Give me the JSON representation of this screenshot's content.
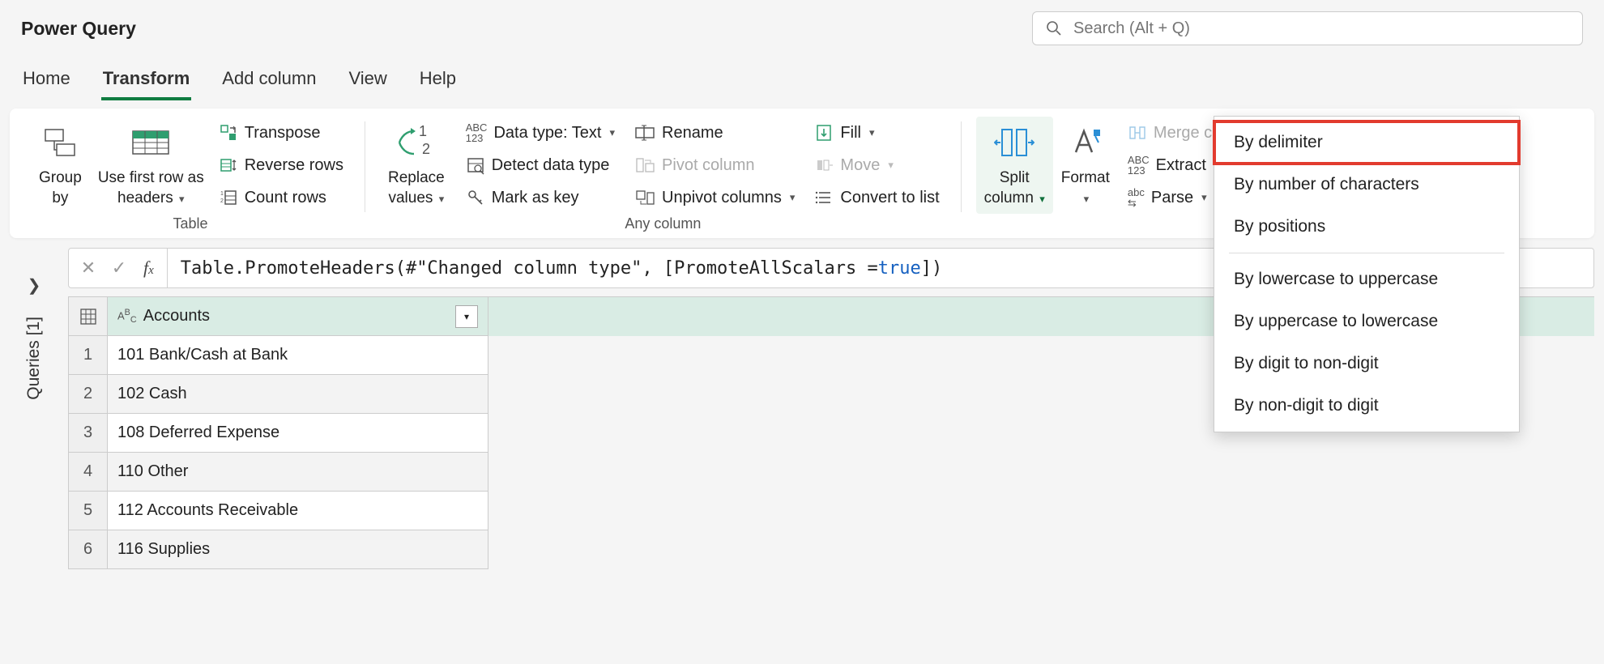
{
  "app": {
    "title": "Power Query"
  },
  "search": {
    "placeholder": "Search (Alt + Q)"
  },
  "tabs": {
    "home": "Home",
    "transform": "Transform",
    "add_column": "Add column",
    "view": "View",
    "help": "Help"
  },
  "ribbon": {
    "group_by": "Group\nby",
    "use_first_row": "Use first row as\nheaders",
    "transpose": "Transpose",
    "reverse_rows": "Reverse rows",
    "count_rows": "Count rows",
    "table_group": "Table",
    "replace_values": "Replace\nvalues",
    "data_type": "Data type: Text",
    "detect": "Detect data type",
    "mark_key": "Mark as key",
    "rename": "Rename",
    "pivot": "Pivot column",
    "unpivot": "Unpivot columns",
    "fill": "Fill",
    "move": "Move",
    "convert_list": "Convert to list",
    "any_column_group": "Any column",
    "split": "Split\ncolumn",
    "format": "Format",
    "merge_columns": "Merge columns",
    "extract": "Extract",
    "parse": "Parse"
  },
  "split_menu": {
    "by_delimiter": "By delimiter",
    "by_num_chars": "By number of characters",
    "by_positions": "By positions",
    "by_lower_upper": "By lowercase to uppercase",
    "by_upper_lower": "By uppercase to lowercase",
    "by_digit_nondigit": "By digit to non-digit",
    "by_nondigit_digit": "By non-digit to digit"
  },
  "queries": {
    "label": "Queries [1]"
  },
  "formula": {
    "prefix": "Table.PromoteHeaders(#\"Changed column type\", [PromoteAllScalars = ",
    "true": "true",
    "suffix": "])"
  },
  "grid": {
    "column_header": "Accounts",
    "rows": [
      "101 Bank/Cash at Bank",
      "102 Cash",
      "108 Deferred Expense",
      "110 Other",
      "112 Accounts Receivable",
      "116 Supplies"
    ]
  }
}
